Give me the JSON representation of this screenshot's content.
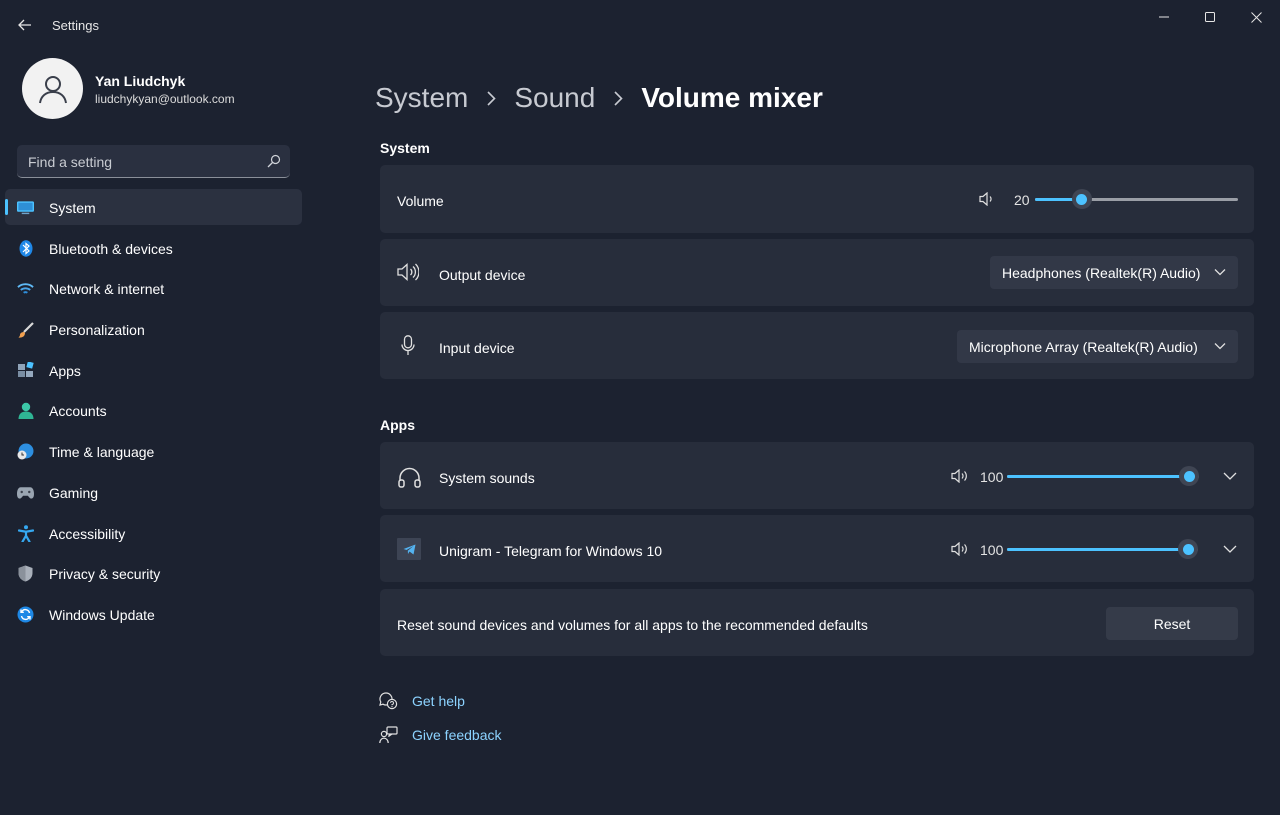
{
  "window": {
    "title": "Settings"
  },
  "user": {
    "name": "Yan Liudchyk",
    "email": "liudchykyan@outlook.com"
  },
  "search": {
    "placeholder": "Find a setting"
  },
  "nav": [
    {
      "label": "System",
      "icon": "monitor-icon",
      "active": true
    },
    {
      "label": "Bluetooth & devices",
      "icon": "bluetooth-icon"
    },
    {
      "label": "Network & internet",
      "icon": "wifi-icon"
    },
    {
      "label": "Personalization",
      "icon": "brush-icon"
    },
    {
      "label": "Apps",
      "icon": "apps-icon"
    },
    {
      "label": "Accounts",
      "icon": "person-icon"
    },
    {
      "label": "Time & language",
      "icon": "globe-clock-icon"
    },
    {
      "label": "Gaming",
      "icon": "gamepad-icon"
    },
    {
      "label": "Accessibility",
      "icon": "accessibility-icon"
    },
    {
      "label": "Privacy & security",
      "icon": "shield-icon"
    },
    {
      "label": "Windows Update",
      "icon": "update-icon"
    }
  ],
  "breadcrumb": {
    "items": [
      "System",
      "Sound"
    ],
    "current": "Volume mixer"
  },
  "system_section": {
    "heading": "System",
    "volume": {
      "label": "Volume",
      "value": "20",
      "level": 0.2
    },
    "output": {
      "label": "Output device",
      "value": "Headphones (Realtek(R) Audio)"
    },
    "input": {
      "label": "Input device",
      "value": "Microphone Array (Realtek(R) Audio)"
    }
  },
  "apps_section": {
    "heading": "Apps",
    "apps": [
      {
        "label": "System sounds",
        "value": "100",
        "level": 1.0,
        "icon": "headphones-icon"
      },
      {
        "label": "Unigram - Telegram for Windows 10",
        "value": "100",
        "level": 1.0,
        "icon": "telegram-icon"
      }
    ],
    "reset": {
      "label": "Reset sound devices and volumes for all apps to the recommended defaults",
      "button": "Reset"
    }
  },
  "links": {
    "help": "Get help",
    "feedback": "Give feedback"
  },
  "colors": {
    "accent": "#4cc2ff",
    "background": "#1c2230",
    "card": "#272d3b"
  }
}
